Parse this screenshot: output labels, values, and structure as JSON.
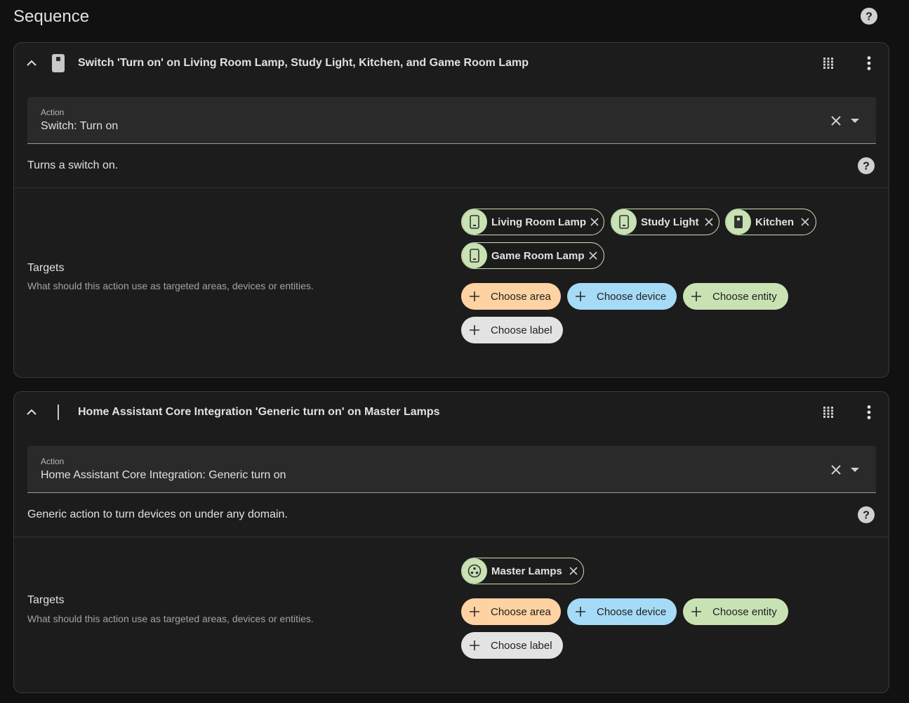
{
  "page": {
    "title": "Sequence",
    "help_icon": "help-circle-icon"
  },
  "colors": {
    "background": "#111111",
    "card": "#1c1c1c",
    "field": "#2a2a2a",
    "chip_green": "#c9e2b4",
    "area": "#ffd2a3",
    "device": "#a6dbf7",
    "entity": "#c9e2b4",
    "label": "#e3e3e3"
  },
  "actions": [
    {
      "title": "Switch 'Turn on' on Living Room Lamp, Study Light, Kitchen, and Game Room Lamp",
      "header_icon": "switch-icon",
      "action_label": "Action",
      "action_value": "Switch: Turn on",
      "description": "Turns a switch on.",
      "targets_label": "Targets",
      "targets_sub": "What should this action use as targeted areas, devices or entities.",
      "chips": [
        {
          "label": "Living Room Lamp",
          "icon": "switch-outline-icon"
        },
        {
          "label": "Study Light",
          "icon": "switch-outline-icon"
        },
        {
          "label": "Kitchen",
          "icon": "switch-filled-icon"
        },
        {
          "label": "Game Room Lamp",
          "icon": "switch-outline-icon"
        }
      ],
      "pickers": {
        "area": "Choose area",
        "device": "Choose device",
        "entity": "Choose entity",
        "label": "Choose label"
      }
    },
    {
      "title": "Home Assistant Core Integration 'Generic turn on' on Master Lamps",
      "header_icon": "divider-icon",
      "action_label": "Action",
      "action_value": "Home Assistant Core Integration: Generic turn on",
      "description": "Generic action to turn devices on under any domain.",
      "targets_label": "Targets",
      "targets_sub": "What should this action use as targeted areas, devices or entities.",
      "chips": [
        {
          "label": "Master Lamps",
          "icon": "group-icon"
        }
      ],
      "pickers": {
        "area": "Choose area",
        "device": "Choose device",
        "entity": "Choose entity",
        "label": "Choose label"
      }
    }
  ]
}
